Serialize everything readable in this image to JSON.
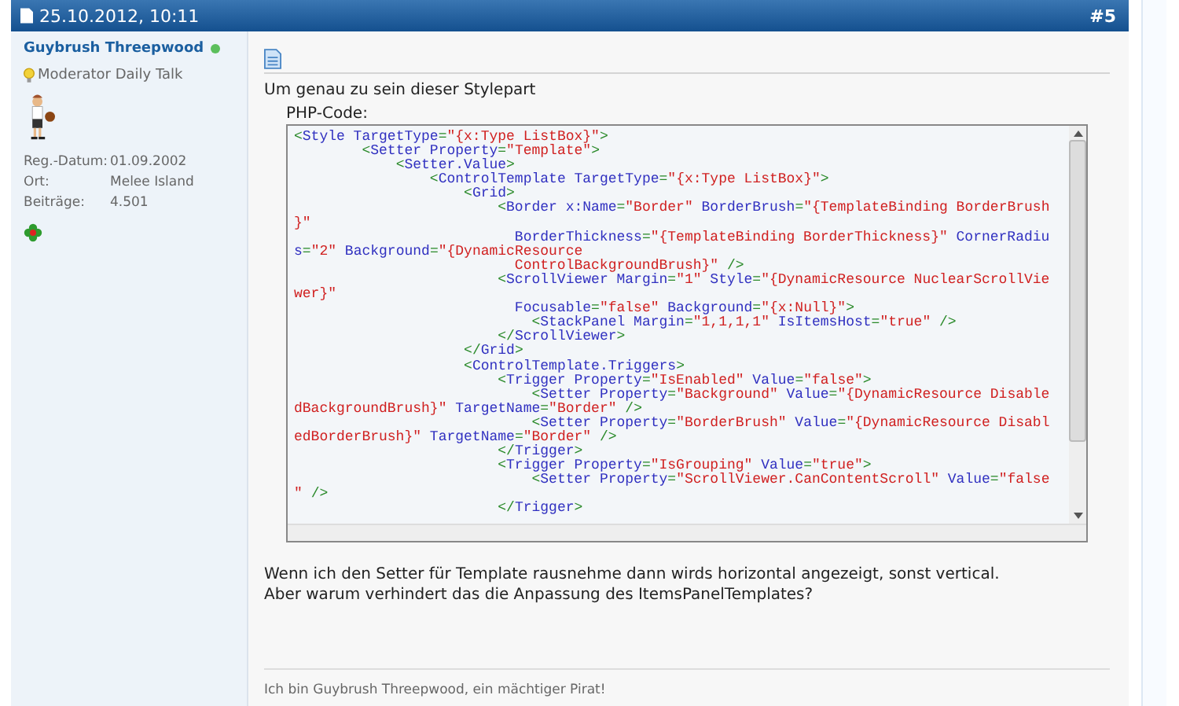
{
  "post": {
    "date": "25.10.2012, 10:11",
    "number": "#5"
  },
  "author": {
    "name": "Guybrush Threepwood",
    "online": true,
    "rank": "Moderator Daily Talk",
    "stats": [
      {
        "label": "Reg.-Datum:",
        "value": "01.09.2002"
      },
      {
        "label": "Ort:",
        "value": "Melee Island"
      },
      {
        "label": "Beiträge:",
        "value": "4.501"
      }
    ]
  },
  "message": {
    "intro": "Um genau zu sein dieser Stylepart",
    "code_label": "PHP-Code:",
    "code_lines": [
      "<Style TargetType=\"{x:Type ListBox}\">",
      "        <Setter Property=\"Template\">",
      "            <Setter.Value>",
      "                <ControlTemplate TargetType=\"{x:Type ListBox}\">",
      "                    <Grid>",
      "                        <Border x:Name=\"Border\" BorderBrush=\"{TemplateBinding BorderBrush",
      "}\"",
      "                          BorderThickness=\"{TemplateBinding BorderThickness}\" CornerRadiu",
      "s=\"2\" Background=\"{DynamicResource",
      "                          ControlBackgroundBrush}\" />",
      "                        <ScrollViewer Margin=\"1\" Style=\"{DynamicResource NuclearScrollVie",
      "wer}\"",
      "                          Focusable=\"false\" Background=\"{x:Null}\">",
      "                            <StackPanel Margin=\"1,1,1,1\" IsItemsHost=\"true\" />",
      "                        </ScrollViewer>",
      "                    </Grid>",
      "                    <ControlTemplate.Triggers>",
      "                        <Trigger Property=\"IsEnabled\" Value=\"false\">",
      "                            <Setter Property=\"Background\" Value=\"{DynamicResource Disable",
      "dBackgroundBrush}\" TargetName=\"Border\" />",
      "                            <Setter Property=\"BorderBrush\" Value=\"{DynamicResource Disabl",
      "edBorderBrush}\" TargetName=\"Border\" />",
      "                        </Trigger>",
      "                        <Trigger Property=\"IsGrouping\" Value=\"true\">",
      "                            <Setter Property=\"ScrollViewer.CanContentScroll\" Value=\"false",
      "\" />",
      "                        </Trigger>"
    ],
    "paragraphs": [
      "Wenn ich den Setter für Template rausnehme dann wirds horizontal angezeigt, sonst vertical.",
      "Aber warum verhindert das die Anpassung des ItemsPanelTemplates?"
    ]
  },
  "signature": "Ich bin Guybrush Threepwood, ein mächtiger Pirat!"
}
